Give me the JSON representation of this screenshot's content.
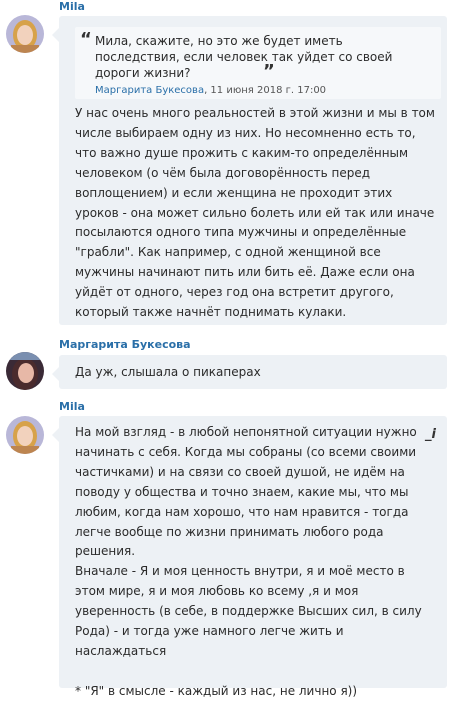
{
  "posts": [
    {
      "author": "Mila",
      "quote": {
        "text": "Мила, скажите, но это же будет иметь последствия, если человек так уйдет со своей дороги жизни?",
        "cite_author": "Маргарита Букесова",
        "cite_date": ", 11 июня 2018 г. 17:00"
      },
      "body": "У нас очень много реальностей в этой жизни и мы в том числе выбираем одну из них. Но несомненно есть то, что важно душе прожить с каким-то определённым человеком (о чём была договорённость перед воплощением) и если женщина не проходит этих уроков - она может сильно болеть или ей так или иначе посылаются одного типа мужчины и определённые \"грабли\". Как например, с одной женщиной все мужчины начинают пить или бить её. Даже если она уйдёт от одного, через год она встретит другого, который также начнёт поднимать кулаки."
    },
    {
      "author": "Маргарита Букесова",
      "body": "Да уж, слышала о пикаперах"
    },
    {
      "author": "Mila",
      "edit_icon": "_i",
      "body": "На мой взгляд - в любой непонятной ситуации нужно начинать с себя. Когда мы собраны (со всеми своими частичками) и на связи со своей душой, не идём на поводу у общества и точно знаем, какие мы, что мы любим, когда нам хорошо, что нам нравится - тогда легче вообще по жизни принимать любого рода решения.\nВначале - Я и моя ценность внутри, я и моё место в этом мире, я и моя любовь ко всему ,я и моя уверенность (в себе, в поддержке Высших сил, в силу Рода) - и тогда уже намного легче жить и наслаждаться\n\n* \"Я\" в смысле - каждый из нас, не лично я))"
    }
  ]
}
